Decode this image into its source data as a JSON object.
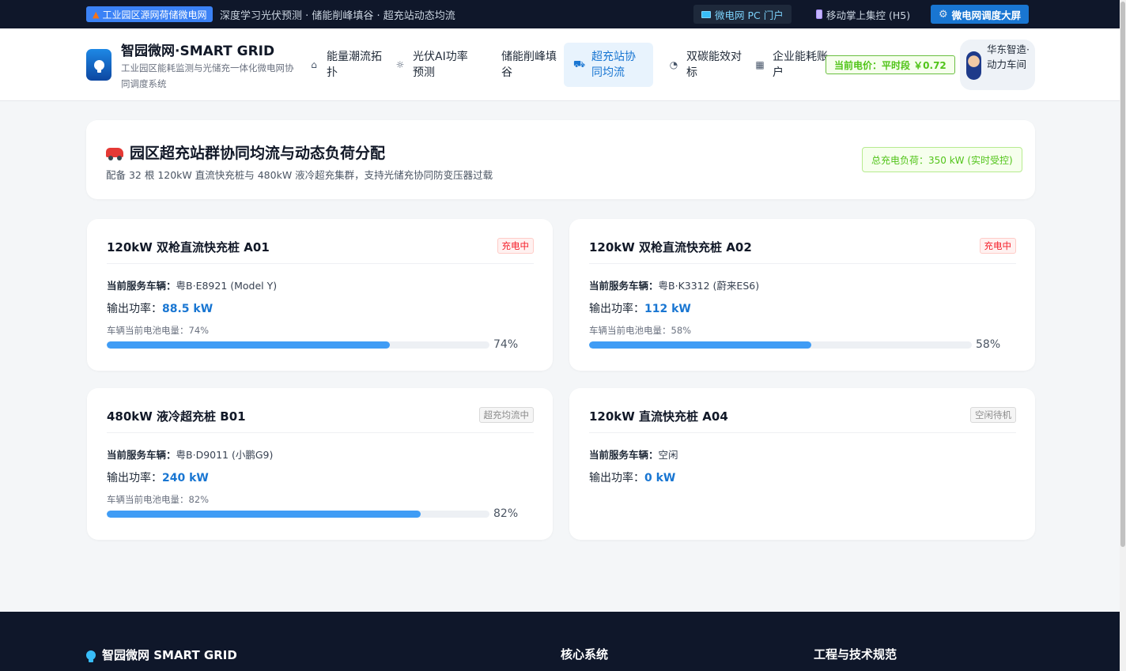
{
  "topbar": {
    "badge": "工业园区源网荷储微电网",
    "tagline": "深度学习光伏预测 · 储能削峰填谷 · 超充站动态均流",
    "links": [
      {
        "label": "微电网 PC 门户",
        "icon": "monitor-icon"
      },
      {
        "label": "移动掌上集控 (H5)",
        "icon": "phone-icon"
      },
      {
        "label": "微电网调度大屏",
        "icon": "gear-icon"
      }
    ]
  },
  "header": {
    "brand_title": "智园微网·SMART GRID",
    "brand_subtitle": "工业园区能耗监测与光储充一体化微电网协同调度系统",
    "nav": [
      {
        "label": "能量潮流拓扑",
        "icon": "topology-icon"
      },
      {
        "label": "光伏AI功率预测",
        "icon": "sun-icon"
      },
      {
        "label": "储能削峰填谷",
        "icon": "battery-icon"
      },
      {
        "label": "超充站协同均流",
        "icon": "truck-icon"
      },
      {
        "label": "双碳能效对标",
        "icon": "pie-icon"
      },
      {
        "label": "企业能耗账户",
        "icon": "building-icon"
      }
    ],
    "active_nav": 3,
    "price": "当前电价：平时段 ￥0.72",
    "user": "华东智造·动力车间"
  },
  "hero": {
    "title": "园区超充站群协同均流与动态负荷分配",
    "subtitle": "配备 32 根 120kW 直流快充桩与 480kW 液冷超充集群，支持光储充协同防变压器过载",
    "total_load": "总充电负荷：350 kW (实时受控)"
  },
  "labels": {
    "vehicle": "当前服务车辆：",
    "power": "输出功率："
  },
  "chargers": [
    {
      "title": "120kW 双枪直流快充桩 A01",
      "status": "充电中",
      "vehicle": "粤B·E8921 (Model Y)",
      "power": "88.5 kW",
      "battery_label": "车辆当前电池电量：74%",
      "battery_pct": "74%",
      "battery": 74
    },
    {
      "title": "120kW 双枪直流快充桩 A02",
      "status": "充电中",
      "vehicle": "粤B·K3312 (蔚来ES6)",
      "power": "112 kW",
      "battery_label": "车辆当前电池电量：58%",
      "battery_pct": "58%",
      "battery": 58
    },
    {
      "title": "480kW 液冷超充桩 B01",
      "status": "超充均流中",
      "vehicle": "粤B·D9011 (小鹏G9)",
      "power": "240 kW",
      "battery_label": "车辆当前电池电量：82%",
      "battery_pct": "82%",
      "battery": 82
    },
    {
      "title": "120kW 直流快充桩 A04",
      "status": "空闲待机",
      "vehicle": "空闲",
      "power": "0 kW"
    }
  ],
  "footer": {
    "brand": "智园微网 SMART GRID",
    "col1": "核心系统",
    "col2": "工程与技术规范"
  },
  "colors": {
    "accent": "#1976d2",
    "topbar_bg": "#0f172a",
    "success": "#52c41a",
    "danger": "#f5222d",
    "bar": "#3f9cf5"
  }
}
